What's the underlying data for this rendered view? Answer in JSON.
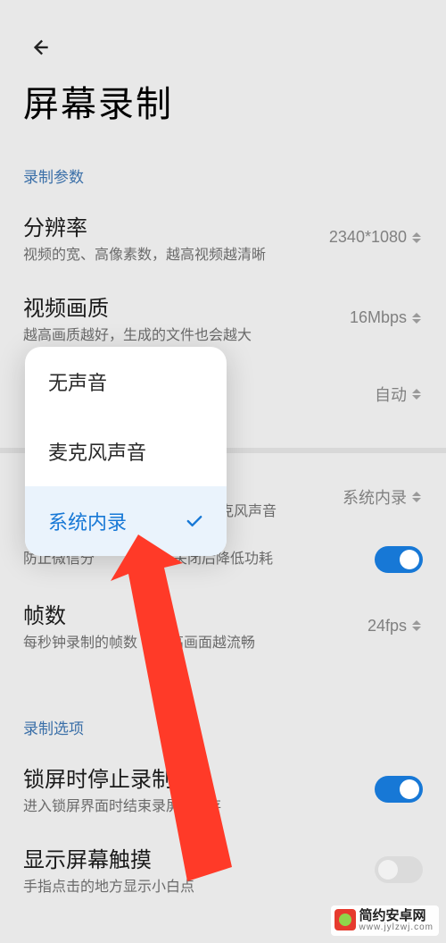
{
  "header": {
    "title": "屏幕录制"
  },
  "sections": {
    "params_label": "录制参数",
    "options_label": "录制选项"
  },
  "settings": {
    "resolution": {
      "title": "分辨率",
      "desc": "视频的宽、高像素数，越高视频越清晰",
      "value": "2340*1080"
    },
    "quality": {
      "title": "视频画质",
      "desc": "越高画质越好，生成的文件也会越大",
      "value": "16Mbps"
    },
    "audio_src_hidden": {
      "value": "自动"
    },
    "audio_src2": {
      "desc_tail": "克风声音",
      "value": "系统内录"
    },
    "wechat": {
      "desc": "防止微信分",
      "desc_tail": "异常，关闭后降低功耗"
    },
    "fps": {
      "title": "帧数",
      "desc_head": "每秒钟录制的帧数",
      "desc_tail": "越高画面越流畅",
      "value": "24fps"
    },
    "lock_stop": {
      "title": "锁屏时停止录制",
      "desc_head": "进入锁屏界面时结束录屏",
      "desc_tail": "保存"
    },
    "show_touch": {
      "title": "显示屏幕触摸",
      "desc": "手指点击的地方显示小白点"
    }
  },
  "popup": {
    "items": [
      "无声音",
      "麦克风声音",
      "系统内录"
    ],
    "selected_index": 2
  },
  "watermark": {
    "name": "简约安卓网",
    "url": "www.jylzwj.com"
  }
}
